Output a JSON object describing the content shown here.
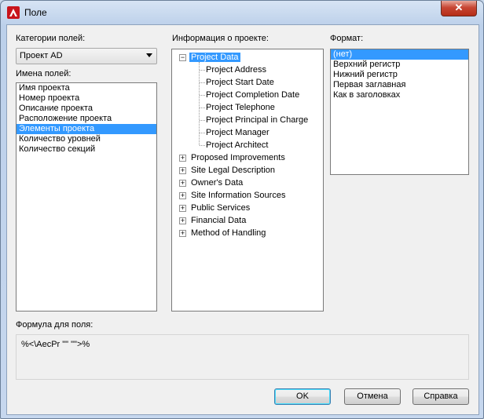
{
  "window": {
    "title": "Поле",
    "close_symbol": "✕"
  },
  "categories": {
    "label": "Категории полей:",
    "selected": "Проект AD"
  },
  "field_names": {
    "label": "Имена полей:",
    "items": [
      "Имя проекта",
      "Номер проекта",
      "Описание проекта",
      "Расположение проекта",
      "Элементы проекта",
      "Количество уровней",
      "Количество секций"
    ],
    "selected_index": 4
  },
  "project_info": {
    "label": "Информация о проекте:",
    "root": "Project Data",
    "children": [
      "Project Address",
      "Project Start Date",
      "Project Completion Date",
      "Project Telephone",
      "Project Principal in Charge",
      "Project Manager",
      "Project Architect"
    ],
    "groups": [
      "Proposed Improvements",
      "Site Legal Description",
      "Owner's Data",
      "Site Information Sources",
      "Public Services",
      "Financial Data",
      "Method of Handling"
    ]
  },
  "format": {
    "label": "Формат:",
    "items": [
      "(нет)",
      "Верхний регистр",
      "Нижний регистр",
      "Первая заглавная",
      "Как в заголовках"
    ],
    "selected_index": 0
  },
  "formula": {
    "label": "Формула для поля:",
    "value": "%<\\AecPr \"\" \"\">%"
  },
  "buttons": {
    "ok": "OK",
    "cancel": "Отмена",
    "help": "Справка"
  }
}
